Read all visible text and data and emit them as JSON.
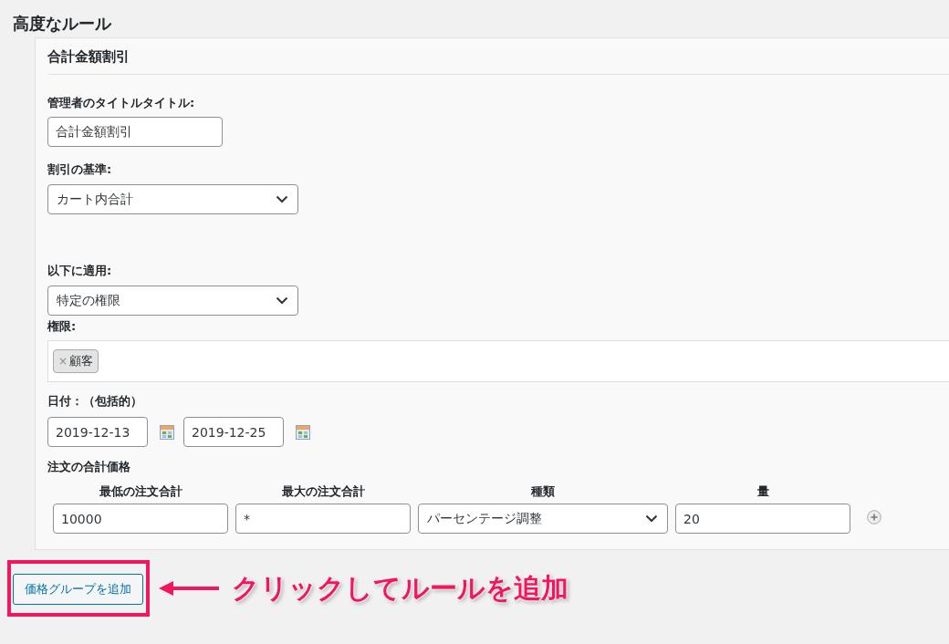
{
  "heading": "高度なルール",
  "rule": {
    "title": "合計金額割引",
    "admin_title": {
      "label": "管理者のタイトルタイトル:",
      "value": "合計金額割引"
    },
    "discount_basis": {
      "label": "割引の基準:",
      "value": "カート内合計"
    },
    "apply_to": {
      "label": "以下に適用:",
      "value": "特定の権限"
    },
    "roles": {
      "label": "権限:",
      "tags": [
        "顧客"
      ],
      "remove_symbol": "×"
    },
    "dates": {
      "label": "日付：（包括的）",
      "from": "2019-12-13",
      "to": "2019-12-25"
    },
    "order_total": {
      "label": "注文の合計価格",
      "columns": [
        "最低の注文合計",
        "最大の注文合計",
        "種類",
        "量"
      ],
      "rows": [
        {
          "min": "10000",
          "max": "*",
          "type": "パーセンテージ調整",
          "amount": "20"
        }
      ]
    }
  },
  "add_button": "価格グループを追加",
  "annotation": {
    "text": "クリックしてルールを追加",
    "highlighted": true
  }
}
